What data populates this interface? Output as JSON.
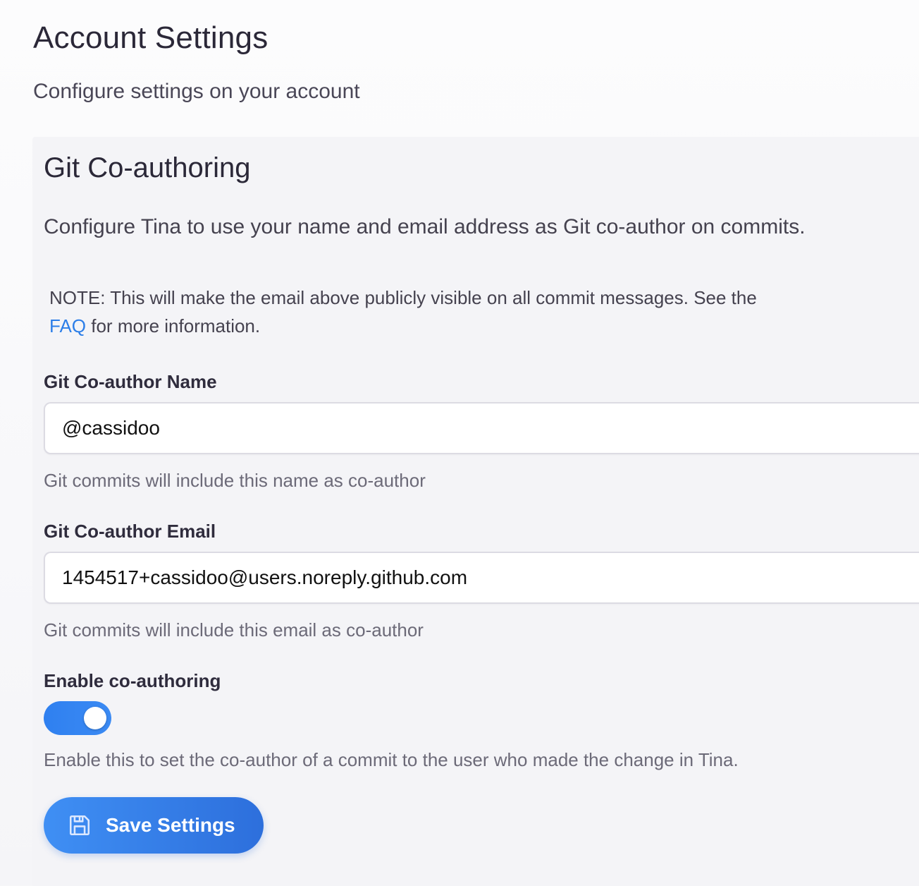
{
  "page": {
    "title": "Account Settings",
    "subtitle": "Configure settings on your account"
  },
  "git_coauthoring": {
    "title": "Git Co-authoring",
    "description": "Configure Tina to use your name and email address as Git co-author on commits.",
    "note_prefix": "NOTE: This will make the email above publicly visible on all commit messages. See the",
    "note_link": "FAQ",
    "note_suffix": "for more information.",
    "name_field": {
      "label": "Git Co-author Name",
      "value": "@cassidoo",
      "help": "Git commits will include this name as co-author"
    },
    "email_field": {
      "label": "Git Co-author Email",
      "value": "1454517+cassidoo@users.noreply.github.com",
      "help": "Git commits will include this email as co-author"
    },
    "enable_toggle": {
      "label": "Enable co-authoring",
      "enabled": true,
      "help": "Enable this to set the co-author of a commit to the user who made the change in Tina."
    },
    "save_button": {
      "label": "Save Settings",
      "icon": "floppy-disk-icon"
    }
  },
  "colors": {
    "accent": "#2f80f0",
    "link": "#2c7ee8",
    "panel_bg": "#f4f4f7"
  }
}
